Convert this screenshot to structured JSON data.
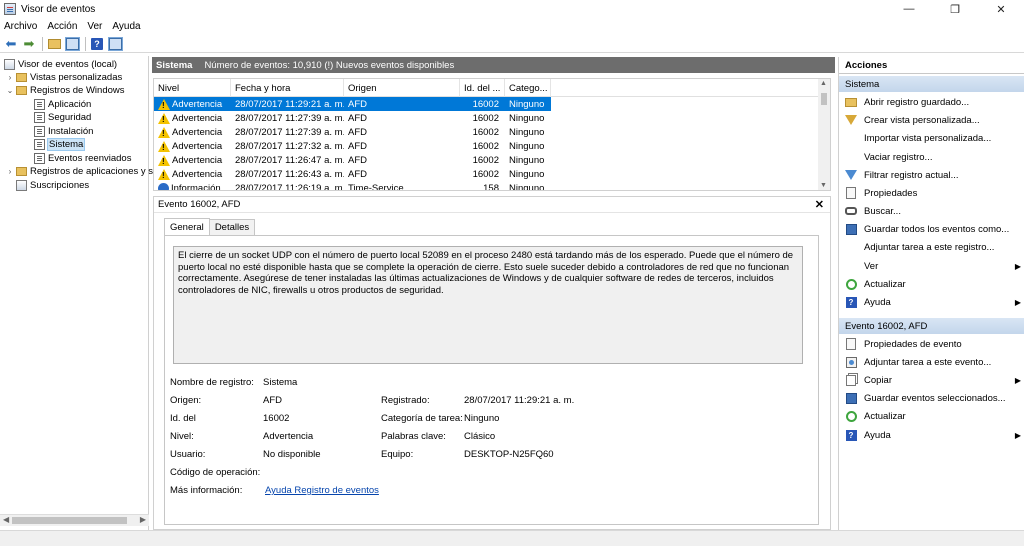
{
  "window": {
    "title": "Visor de eventos",
    "controls": [
      "—",
      "❐",
      "✕"
    ]
  },
  "menu": [
    "Archivo",
    "Acción",
    "Ver",
    "Ayuda"
  ],
  "tree": {
    "items": [
      {
        "label": "Visor de eventos (local)",
        "twisty": ""
      },
      {
        "label": "Vistas personalizadas",
        "twisty": "›"
      },
      {
        "label": "Registros de Windows",
        "twisty": "⌄"
      },
      {
        "label": "Aplicación",
        "twisty": ""
      },
      {
        "label": "Seguridad",
        "twisty": ""
      },
      {
        "label": "Instalación",
        "twisty": ""
      },
      {
        "label": "Sistema",
        "twisty": ""
      },
      {
        "label": "Eventos reenviados",
        "twisty": ""
      },
      {
        "label": "Registros de aplicaciones y s",
        "twisty": "›"
      },
      {
        "label": "Suscripciones",
        "twisty": ""
      }
    ]
  },
  "center": {
    "title": "Sistema",
    "info": "Número de eventos: 10,910 (!) Nuevos eventos disponibles"
  },
  "grid": {
    "columns": [
      "Nivel",
      "Fecha y hora",
      "Origen",
      "Id. del ...",
      "Catego..."
    ],
    "rows": [
      {
        "level": "Advertencia",
        "date": "28/07/2017 11:29:21 a. m.",
        "source": "AFD",
        "id": "16002",
        "category": "Ninguno"
      },
      {
        "level": "Advertencia",
        "date": "28/07/2017 11:27:39 a. m.",
        "source": "AFD",
        "id": "16002",
        "category": "Ninguno"
      },
      {
        "level": "Advertencia",
        "date": "28/07/2017 11:27:39 a. m.",
        "source": "AFD",
        "id": "16002",
        "category": "Ninguno"
      },
      {
        "level": "Advertencia",
        "date": "28/07/2017 11:27:32 a. m.",
        "source": "AFD",
        "id": "16002",
        "category": "Ninguno"
      },
      {
        "level": "Advertencia",
        "date": "28/07/2017 11:26:47 a. m.",
        "source": "AFD",
        "id": "16002",
        "category": "Ninguno"
      },
      {
        "level": "Advertencia",
        "date": "28/07/2017 11:26:43 a. m.",
        "source": "AFD",
        "id": "16002",
        "category": "Ninguno"
      },
      {
        "level": "Información",
        "date": "28/07/2017 11:26:19 a. m.",
        "source": "Time-Service",
        "id": "158",
        "category": "Ninguno"
      }
    ]
  },
  "detail": {
    "title": "Evento 16002, AFD",
    "close": "✕",
    "tabs": [
      "General",
      "Detalles"
    ],
    "description": "El cierre de un socket UDP con el número de puerto local 52089 en el proceso 2480 está tardando más de los esperado. Puede que el número de puerto local no esté disponible hasta que se complete la operación de cierre. Esto suele suceder debido a controladores de red que no funcionan correctamente. Asegúrese de tener instaladas las últimas actualizaciones de Windows y de cualquier software de redes de terceros, incluidos controladores de NIC, firewalls u otros productos de seguridad.",
    "fields": {
      "log_name_label": "Nombre de registro:",
      "log_name": "Sistema",
      "source_label": "Origen:",
      "source": "AFD",
      "logged_label": "Registrado:",
      "logged": "28/07/2017 11:29:21 a. m.",
      "id_label": "Id. del",
      "id": "16002",
      "task_label": "Categoría de tarea:",
      "task": "Ninguno",
      "level_label": "Nivel:",
      "level": "Advertencia",
      "keywords_label": "Palabras clave:",
      "keywords": "Clásico",
      "user_label": "Usuario:",
      "user": "No disponible",
      "computer_label": "Equipo:",
      "computer": "DESKTOP-N25FQ60",
      "opcode_label": "Código de operación:",
      "opcode": "",
      "more_info_label": "Más información:",
      "more_info_link": "Ayuda Registro de eventos"
    }
  },
  "actions": {
    "title": "Acciones",
    "section1": "Sistema",
    "items1": [
      {
        "label": "Abrir registro guardado...",
        "icon": "folder-icon"
      },
      {
        "label": "Crear vista personalizada...",
        "icon": "filter-icon"
      },
      {
        "label": "Importar vista personalizada...",
        "icon": ""
      },
      {
        "label": "Vaciar registro...",
        "icon": ""
      },
      {
        "label": "Filtrar registro actual...",
        "icon": "filter-icon"
      },
      {
        "label": "Propiedades",
        "icon": "properties-icon"
      },
      {
        "label": "Buscar...",
        "icon": "binoculars-icon"
      },
      {
        "label": "Guardar todos los eventos como...",
        "icon": "save-icon"
      },
      {
        "label": "Adjuntar tarea a este registro...",
        "icon": ""
      },
      {
        "label": "Ver",
        "icon": "",
        "submenu": "▶"
      },
      {
        "label": "Actualizar",
        "icon": "refresh-icon"
      },
      {
        "label": "Ayuda",
        "icon": "help-icon",
        "submenu": "▶"
      }
    ],
    "section2": "Evento 16002, AFD",
    "items2": [
      {
        "label": "Propiedades de evento",
        "icon": "properties-icon"
      },
      {
        "label": "Adjuntar tarea a este evento...",
        "icon": "task-icon"
      },
      {
        "label": "Copiar",
        "icon": "copy-icon",
        "submenu": "▶"
      },
      {
        "label": "Guardar eventos seleccionados...",
        "icon": "save-icon"
      },
      {
        "label": "Actualizar",
        "icon": "refresh-icon"
      },
      {
        "label": "Ayuda",
        "icon": "help-icon",
        "submenu": "▶"
      }
    ]
  }
}
